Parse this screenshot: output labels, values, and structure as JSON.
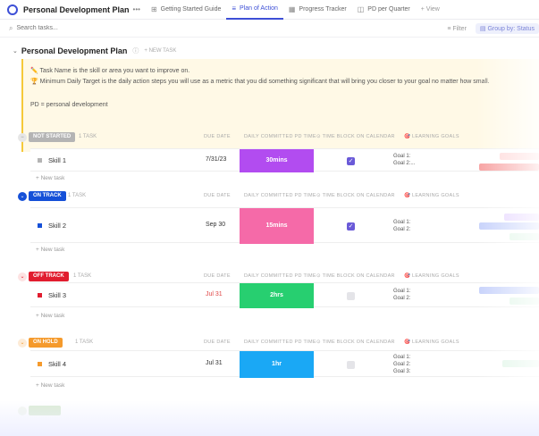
{
  "app": {
    "title": "Personal Development Plan",
    "more": "•••"
  },
  "tabs": [
    {
      "label": "Getting Started Guide",
      "icon": "⊞"
    },
    {
      "label": "Plan of Action",
      "icon": "≡"
    },
    {
      "label": "Progress Tracker",
      "icon": "▦"
    },
    {
      "label": "PD per Quarter",
      "icon": "◫"
    },
    {
      "label": "+ View",
      "icon": ""
    }
  ],
  "toolbar": {
    "search_placeholder": "Search tasks...",
    "filter": "Filter",
    "group": "Group by: Status"
  },
  "list": {
    "title": "Personal Development Plan",
    "new_task": "+ NEW TASK"
  },
  "note": {
    "line1": "✏️ Task Name is the skill or area you want to improve on.",
    "line2": "🏆 Minimum Daily Target is the daily action steps you will use as a metric that you did something significant that will bring you closer to your goal no matter how small.",
    "line3": "PD = personal development"
  },
  "columns": {
    "due": "DUE DATE",
    "daily": "DAILY COMMITTED PD TIME",
    "timeblock": "TIME BLOCK ON CALENDAR",
    "learning": "LEARNING GOALS"
  },
  "groups": [
    {
      "status": "NOT STARTED",
      "count": "1 TASK",
      "color": "#b4b4b4",
      "caret": "−",
      "task": {
        "name": "Skill 1",
        "date": "7/31/23",
        "time": "30mins",
        "time_color": "#b24cf0",
        "checked": true,
        "goal1": "Goal 1:",
        "goal2": "Goal 2:..."
      },
      "new_task": "+ New task"
    },
    {
      "status": "ON TRACK",
      "count": "1 TASK",
      "color": "#1550d8",
      "caret": "⌄",
      "task": {
        "name": "Skill 2",
        "date": "Sep 30",
        "time": "15mins",
        "time_color": "#f56aa8",
        "checked": true,
        "goal1": "Goal 1:",
        "goal2": "Goal 2:"
      },
      "new_task": "+ New task"
    },
    {
      "status": "OFF TRACK",
      "count": "1 TASK",
      "color": "#e11d2f",
      "caret": "⌄",
      "task": {
        "name": "Skill 3",
        "date": "Jul 31",
        "time": "2hrs",
        "time_color": "#27cf70",
        "checked": false,
        "goal1": "Goal 1:",
        "goal2": "Goal 2:"
      },
      "new_task": "+ New task"
    },
    {
      "status": "ON HOLD",
      "count": "1 TASK",
      "color": "#f59a2c",
      "caret": "⌄",
      "task": {
        "name": "Skill 4",
        "date": "Jul 31",
        "time": "1hr",
        "time_color": "#1aa8f5",
        "checked": false,
        "goal1": "Goal 1:",
        "goal2": "Goal 2:",
        "goal3": "Goal 3:"
      },
      "new_task": "+ New task"
    }
  ],
  "colors": {
    "accent": "#3d4fd6",
    "note_bg": "#fff9e6",
    "note_border": "#f5c93a"
  }
}
